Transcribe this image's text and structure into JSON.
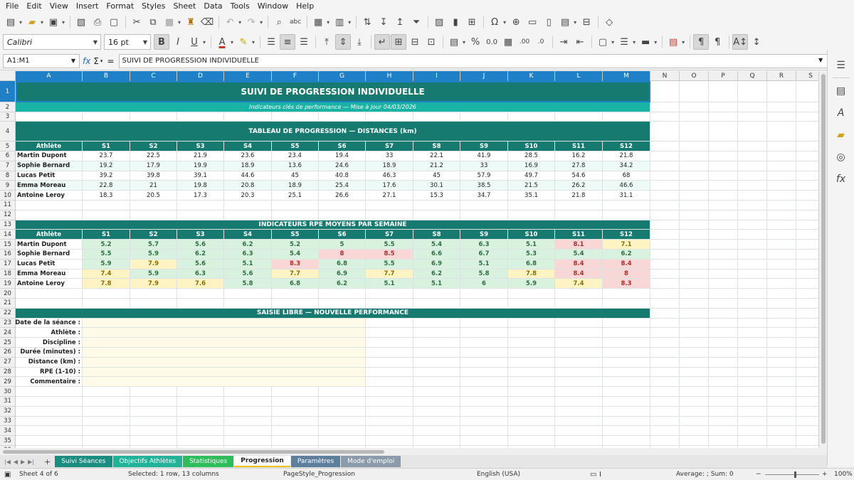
{
  "menu": [
    "File",
    "Edit",
    "View",
    "Insert",
    "Format",
    "Styles",
    "Sheet",
    "Data",
    "Tools",
    "Window",
    "Help"
  ],
  "toolbar": {
    "font_name": "Calibri",
    "font_size": "16 pt"
  },
  "formula_bar": {
    "cell_ref": "A1:M1",
    "content": "SUIVI DE PROGRESSION INDIVIDUELLE",
    "fx_label": "fx",
    "sum_label": "Σ",
    "eq_label": "="
  },
  "columns": [
    "A",
    "B",
    "C",
    "D",
    "E",
    "F",
    "G",
    "H",
    "I",
    "J",
    "K",
    "L",
    "M",
    "N",
    "O",
    "P",
    "Q",
    "R",
    "S"
  ],
  "rows": [
    "1",
    "2",
    "3",
    "4",
    "5",
    "6",
    "7",
    "8",
    "9",
    "10",
    "11",
    "12",
    "13",
    "14",
    "15",
    "16",
    "17",
    "18",
    "19",
    "20",
    "21",
    "22",
    "23",
    "24",
    "25",
    "26",
    "27",
    "28",
    "29",
    "30",
    "31",
    "32",
    "33",
    "34",
    "35",
    "36"
  ],
  "sheet": {
    "title": "SUIVI DE PROGRESSION INDIVIDUELLE",
    "subtitle": "Indicateurs clés de performance  —  Mise à jour 04/03/2026",
    "distances": {
      "section_title": "TABLEAU DE PROGRESSION — DISTANCES (km)",
      "headers": [
        "Athlète",
        "S1",
        "S2",
        "S3",
        "S4",
        "S5",
        "S6",
        "S7",
        "S8",
        "S9",
        "S10",
        "S11",
        "S12"
      ],
      "rows": [
        [
          "Martin Dupont",
          "23.7",
          "22.5",
          "21.9",
          "23.6",
          "23.4",
          "19.4",
          "33",
          "22.1",
          "41.9",
          "28.5",
          "16.2",
          "21.8"
        ],
        [
          "Sophie Bernard",
          "19.2",
          "17.9",
          "19.9",
          "18.9",
          "13.6",
          "24.6",
          "18.9",
          "21.2",
          "33",
          "16.9",
          "27.8",
          "34.2"
        ],
        [
          "Lucas Petit",
          "39.2",
          "39.8",
          "39.1",
          "44.6",
          "45",
          "40.8",
          "46.3",
          "45",
          "57.9",
          "49.7",
          "54.6",
          "68"
        ],
        [
          "Emma Moreau",
          "22.8",
          "21",
          "19.8",
          "20.8",
          "18.9",
          "25.4",
          "17.6",
          "30.1",
          "38.5",
          "21.5",
          "26.2",
          "46.6"
        ],
        [
          "Antoine Leroy",
          "18.3",
          "20.5",
          "17.3",
          "20.3",
          "25.1",
          "26.6",
          "27.1",
          "15.3",
          "34.7",
          "35.1",
          "21.8",
          "31.1"
        ]
      ]
    },
    "rpe": {
      "section_title": "INDICATEURS RPE MOYENS PAR SEMAINE",
      "headers": [
        "Athlète",
        "S1",
        "S2",
        "S3",
        "S4",
        "S5",
        "S6",
        "S7",
        "S8",
        "S9",
        "S10",
        "S11",
        "S12"
      ],
      "rows": [
        [
          "Martin Dupont",
          "5.2",
          "5.7",
          "5.6",
          "6.2",
          "5.2",
          "5",
          "5.5",
          "5.4",
          "6.3",
          "5.1",
          "8.1",
          "7.1"
        ],
        [
          "Sophie Bernard",
          "5.5",
          "5.9",
          "6.2",
          "6.3",
          "5.4",
          "8",
          "8.5",
          "6.6",
          "6.7",
          "5.3",
          "5.4",
          "6.2"
        ],
        [
          "Lucas Petit",
          "5.9",
          "7.9",
          "5.6",
          "5.1",
          "8.3",
          "6.8",
          "5.5",
          "6.9",
          "5.1",
          "6.8",
          "8.4",
          "8.4"
        ],
        [
          "Emma Moreau",
          "7.4",
          "5.9",
          "6.3",
          "5.6",
          "7.7",
          "6.9",
          "7.7",
          "6.2",
          "5.8",
          "7.8",
          "8.4",
          "8"
        ],
        [
          "Antoine Leroy",
          "7.8",
          "7.9",
          "7.6",
          "5.8",
          "6.8",
          "6.2",
          "5.1",
          "5.1",
          "6",
          "5.9",
          "7.4",
          "8.3"
        ]
      ]
    },
    "form": {
      "section_title": "SAISIE LIBRE — NOUVELLE PERFORMANCE",
      "labels": [
        "Date de la séance :",
        "Athlète :",
        "Discipline :",
        "Durée (minutes) :",
        "Distance (km) :",
        "RPE (1-10) :",
        "Commentaire :"
      ]
    }
  },
  "tabs": [
    {
      "label": "Suivi Séances",
      "color": "#1a8c80",
      "text": "#ffffff"
    },
    {
      "label": "Objectifs Athlètes",
      "color": "#21b39a",
      "text": "#ffffff"
    },
    {
      "label": "Statistiques",
      "color": "#2ebd5a",
      "text": "#ffffff"
    },
    {
      "label": "Progression",
      "color": "#ffffff",
      "text": "#222222"
    },
    {
      "label": "Paramètres",
      "color": "#5d7f9c",
      "text": "#ffffff"
    },
    {
      "label": "Mode d'emploi",
      "color": "#8c9bab",
      "text": "#ffffff"
    }
  ],
  "status": {
    "sheet": "Sheet 4 of 6",
    "selection": "Selected: 1 row, 13 columns",
    "page_style": "PageStyle_Progression",
    "language": "English (USA)",
    "stats": "Average: ; Sum: 0",
    "zoom": "100%"
  },
  "colors": {
    "teal_dark": "#167a70",
    "teal_light": "#18b3a4",
    "selection": "#1f80c8"
  }
}
